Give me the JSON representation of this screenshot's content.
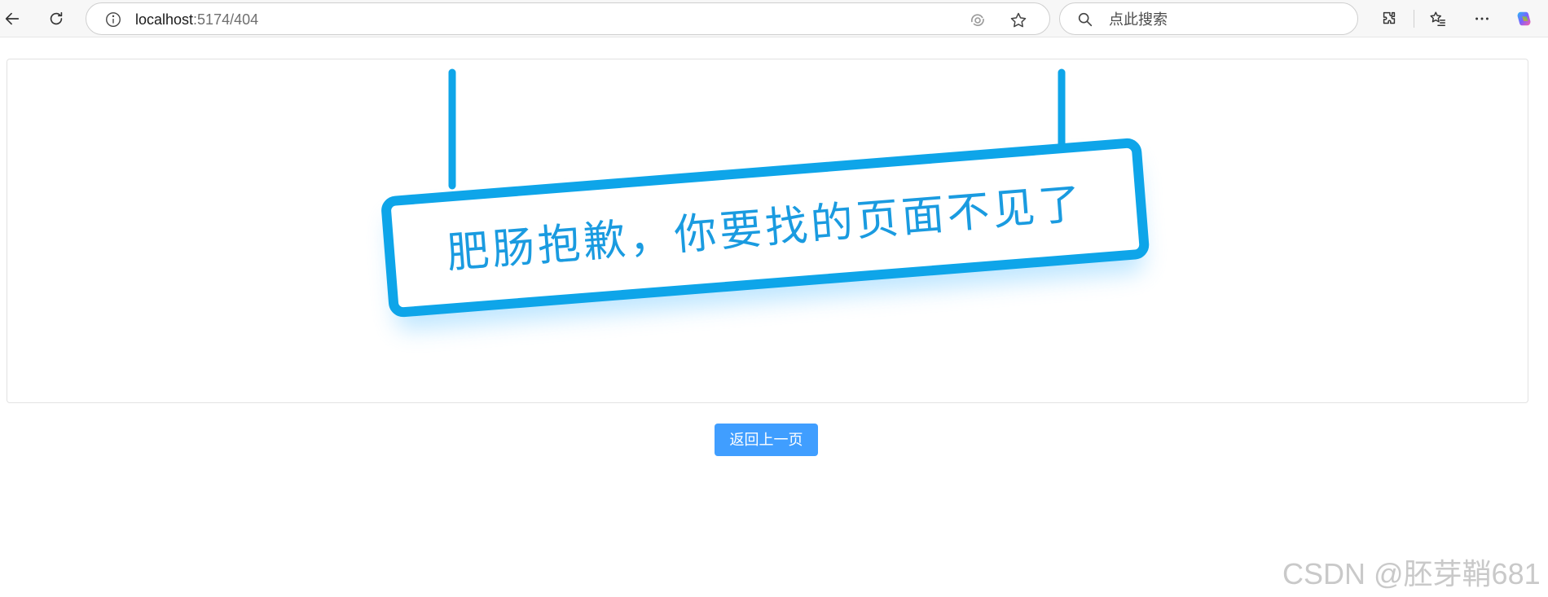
{
  "browser": {
    "url_host": "localhost",
    "url_path": ":5174/404",
    "search_placeholder": "点此搜索"
  },
  "page": {
    "sign_text": "肥肠抱歉，你要找的页面不见了",
    "back_button_label": "返回上一页"
  },
  "watermark": "CSDN @胚芽鞘681",
  "colors": {
    "sign_blue": "#0ea5e9",
    "button_blue": "#409eff"
  }
}
